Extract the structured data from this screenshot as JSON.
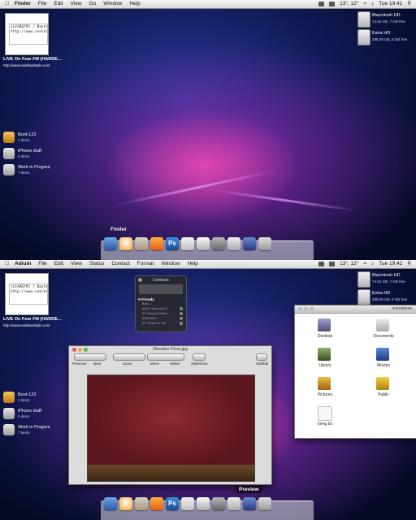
{
  "colors": {
    "wallpaper_top": "#1a2a80",
    "wallpaper_glow": "#ff50b4",
    "dock": "#c8c8d8"
  },
  "screen1": {
    "menubar": {
      "app": "Finder",
      "menus": [
        "File",
        "Edit",
        "View",
        "Go",
        "Window",
        "Help"
      ],
      "status": "13°, 12°",
      "clock": "Tue 19:41"
    },
    "drives": [
      {
        "name": "Macintosh HD",
        "info": "74.53 GB, 7 GB free"
      },
      {
        "name": "Extra HD",
        "info": "298.09 GB, 8 GB free"
      }
    ],
    "thumb": {
      "lines": [
        "[LFAREFM] / Baxter ] - P",
        "http://www.realhardstyle"
      ],
      "title": "LIVE On Fear FM (HARDE...",
      "url": "http://www.realhardstyle.com"
    },
    "stacks": [
      {
        "name": "Boot-123",
        "count": "2 items",
        "icon": "folder-icon"
      },
      {
        "name": "iPhone stuff",
        "count": "6 items",
        "icon": "folder-icon"
      },
      {
        "name": "Work in Progres",
        "count": "7 items",
        "icon": "folder-icon"
      }
    ],
    "dock_label": "Finder"
  },
  "screen2": {
    "menubar": {
      "app": "Adium",
      "menus": [
        "File",
        "Edit",
        "View",
        "Status",
        "Contact",
        "Format",
        "Window",
        "Help"
      ],
      "status": "13°, 12°",
      "clock": "Tue 19:42"
    },
    "drives": [
      {
        "name": "Macintosh HD",
        "info": "74.53 GB, 7 GB free"
      },
      {
        "name": "Extra HD",
        "info": "298.09 GB, 8 GB free"
      }
    ],
    "thumb": {
      "lines": [
        "[LFAREFM] / Baxter ] - P",
        "http://www.realhardstyle"
      ],
      "title": "LIVE On Fear FM (HARDE...",
      "url": "http://www.realhardstyle.com"
    },
    "stacks": [
      {
        "name": "Boot-123",
        "count": "2 items",
        "icon": "folder-icon"
      },
      {
        "name": "iPhone stuff",
        "count": "6 items",
        "icon": "folder-icon"
      },
      {
        "name": "Work in Progres",
        "count": "7 items",
        "icon": "folder-icon"
      }
    ],
    "contacts": {
      "title": "Contacts",
      "group": "Friends",
      "rows": [
        "Boot-1",
        "BAXX: Spec Next S",
        "RT: Samp DJ Padre",
        "BARRENCT",
        "RT: Timber DJ Pad"
      ]
    },
    "preview": {
      "title": "Wooden Floor.jpg",
      "tools": [
        "Previous",
        "Next",
        "Zoom",
        "Move",
        "Select",
        "Slideshow",
        "Sidebar"
      ]
    },
    "preview_label": "Preview",
    "finder": {
      "title": "nvandepas",
      "items": [
        {
          "label": "Desktop",
          "icon": "desktop-folder-icon"
        },
        {
          "label": "Documents",
          "icon": "documents-folder-icon"
        },
        {
          "label": "Library",
          "icon": "library-folder-icon"
        },
        {
          "label": "Movies",
          "icon": "movies-folder-icon"
        },
        {
          "label": "Pictures",
          "icon": "pictures-folder-icon"
        },
        {
          "label": "Public",
          "icon": "public-folder-icon"
        },
        {
          "label": "ioreg.txt",
          "icon": "text-file-icon"
        }
      ]
    }
  }
}
